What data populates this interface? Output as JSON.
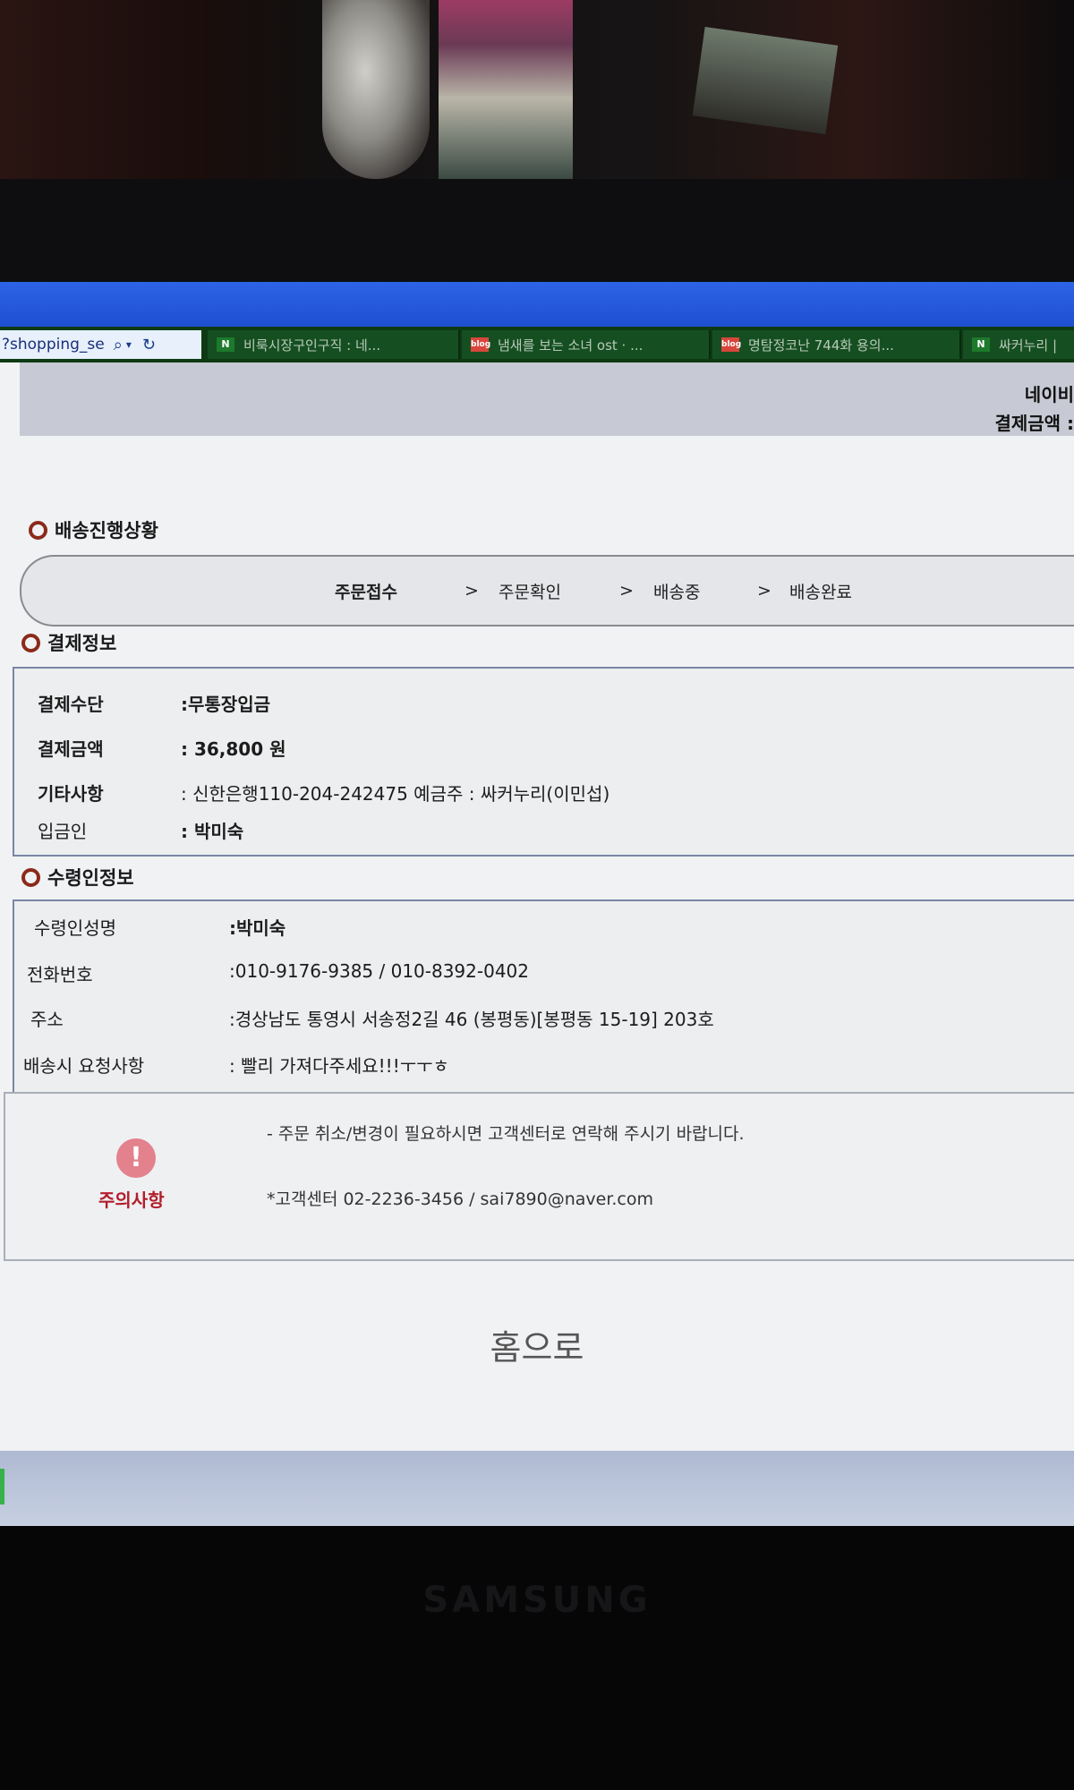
{
  "browser": {
    "address": "?shopping_se",
    "tabs": [
      {
        "icon": "N",
        "label": "비룩시장구인구직 : 네..."
      },
      {
        "icon": "blog",
        "label": "냄새를 보는 소녀 ost · ..."
      },
      {
        "icon": "blog",
        "label": "명탐정코난 744화 용의..."
      },
      {
        "icon": "N",
        "label": "싸커누리 |"
      }
    ]
  },
  "header": {
    "line1": "네이비",
    "line2": "결제금액 :"
  },
  "delivery": {
    "title": "배송진행상황",
    "steps": [
      "주문접수",
      "주문확인",
      "배송중",
      "배송완료"
    ],
    "arrow": ">"
  },
  "payment": {
    "title": "결제정보",
    "rows": [
      {
        "label": "결제수단",
        "value": ":무통장입금"
      },
      {
        "label": "결제금액",
        "value": ": 36,800 원"
      },
      {
        "label": "기타사항",
        "value": ": 신한은행110-204-242475  예금주 : 싸커누리(이민섭)"
      },
      {
        "label": "입금인",
        "value": ": 박미숙"
      }
    ]
  },
  "recipient": {
    "title": "수령인정보",
    "rows": [
      {
        "label": "수령인성명",
        "value": ":박미숙"
      },
      {
        "label": "전화번호",
        "value": ":010-9176-9385 / 010-8392-0402"
      },
      {
        "label": "주소",
        "value": ":경상남도 통영시 서송정2길 46 (봉평동)[봉평동 15-19] 203호"
      },
      {
        "label": "배송시 요청사항",
        "value": ": 빨리 가져다주세요!!!ㅜㅜㅎ"
      }
    ]
  },
  "notice": {
    "label": "주의사항",
    "line1": "- 주문 취소/변경이 필요하시면 고객센터로 연락해 주시기 바랍니다.",
    "line2": "*고객센터   02-2236-3456 /  sai7890@naver.com"
  },
  "home_link": "홈으로",
  "monitor_brand": "SAMSUNG"
}
